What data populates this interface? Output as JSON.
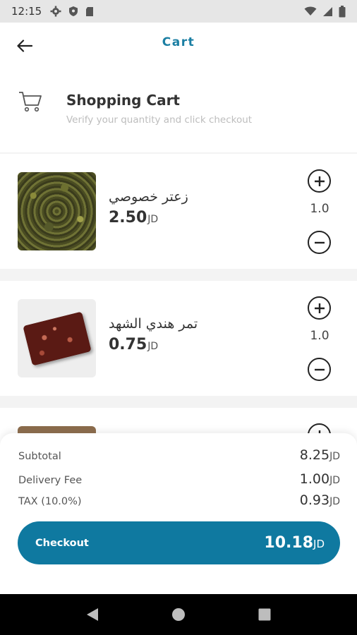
{
  "status": {
    "time": "12:15"
  },
  "app": {
    "title": "Cart"
  },
  "header": {
    "title": "Shopping Cart",
    "subtitle": "Verify your quantity and click checkout"
  },
  "items": [
    {
      "name": "زعتر خصوصي",
      "price": "2.50",
      "currency": "JD",
      "quantity": "1.0"
    },
    {
      "name": "تمر هندي الشهد",
      "price": "0.75",
      "currency": "JD",
      "quantity": "1.0"
    }
  ],
  "summary": {
    "subtotal_label": "Subtotal",
    "subtotal": "8.25",
    "currency": "JD",
    "delivery_label": "Delivery Fee",
    "delivery": "1.00",
    "tax_label": "TAX (10.0%)",
    "tax": "0.93"
  },
  "checkout": {
    "label": "Checkout",
    "total": "10.18",
    "currency": "JD"
  },
  "colors": {
    "accent": "#0f79a0",
    "title": "#1b7fa3"
  }
}
